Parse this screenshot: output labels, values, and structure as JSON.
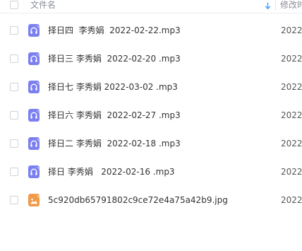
{
  "header": {
    "name_label": "文件名",
    "date_label": "修改时间",
    "sort_icon": "arrow-down-icon"
  },
  "colors": {
    "audio_icon": "#7b7ff0",
    "image_icon": "#f2994a",
    "header_text": "#8a8f99",
    "sort_arrow": "#3aa0ff"
  },
  "files": [
    {
      "name": "择日四  李秀娟  2022-02-22.mp3",
      "type": "audio",
      "icon": "headphones-icon",
      "date": "2022"
    },
    {
      "name": "择日三 李秀娟  2022-02-20 .mp3",
      "type": "audio",
      "icon": "headphones-icon",
      "date": "2022"
    },
    {
      "name": "择日七 李秀娟 2022-03-02 .mp3",
      "type": "audio",
      "icon": "headphones-icon",
      "date": "2022"
    },
    {
      "name": "择日六 李秀娟  2022-02-27 .mp3",
      "type": "audio",
      "icon": "headphones-icon",
      "date": "2022"
    },
    {
      "name": "择日二 李秀娟  2022-02-18 .mp3",
      "type": "audio",
      "icon": "headphones-icon",
      "date": "2022"
    },
    {
      "name": "择日 李秀娟   2022-02-16 .mp3",
      "type": "audio",
      "icon": "headphones-icon",
      "date": "2022"
    },
    {
      "name": "5c920db65791802c9ce72e4a75a42b9.jpg",
      "type": "image",
      "icon": "image-file-icon",
      "date": "2022"
    }
  ]
}
